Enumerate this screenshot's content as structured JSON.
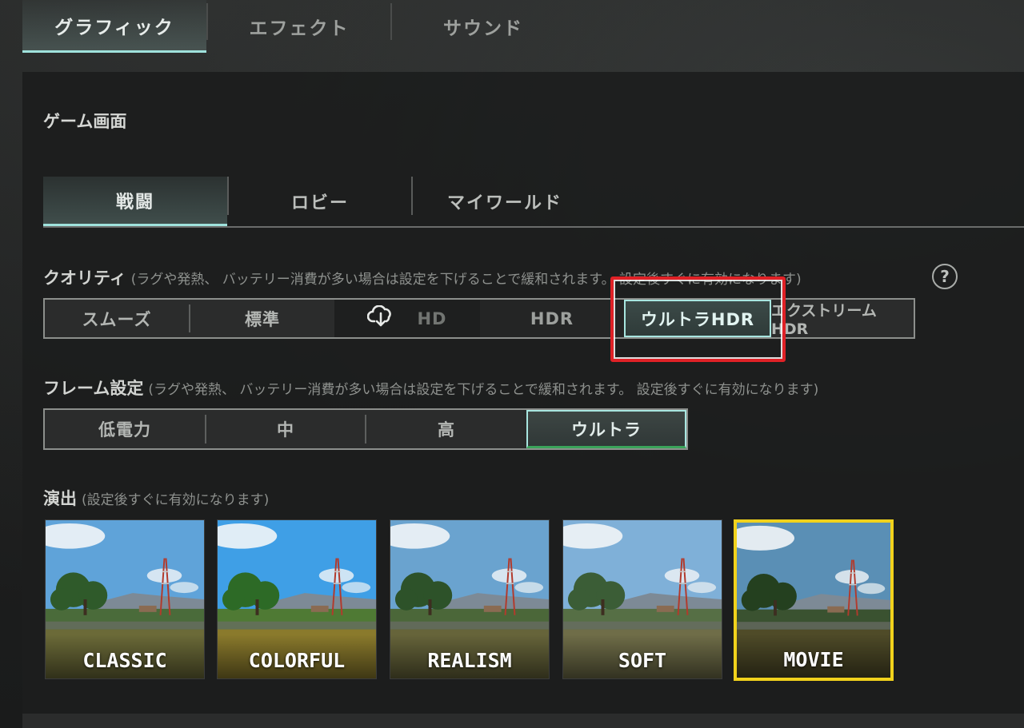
{
  "top_tabs": [
    "グラフィック",
    "エフェクト",
    "サウンド"
  ],
  "section_title": "ゲーム画面",
  "sub_tabs": [
    "戦闘",
    "ロビー",
    "マイワールド"
  ],
  "quality": {
    "label": "クオリティ",
    "note": "(ラグや発熱、 バッテリー消費が多い場合は設定を下げることで緩和されます。 設定後すぐに有効になります)",
    "options": [
      "スムーズ",
      "標準",
      "HD",
      "HDR",
      "ウルトラHDR",
      "エクストリームHDR"
    ],
    "selected": "ウルトラHDR",
    "help_icon": "?"
  },
  "frame": {
    "label": "フレーム設定",
    "note": "(ラグや発熱、 バッテリー消費が多い場合は設定を下げることで緩和されます。 設定後すぐに有効になります)",
    "options": [
      "低電力",
      "中",
      "高",
      "ウルトラ"
    ],
    "selected": "ウルトラ"
  },
  "style": {
    "label": "演出",
    "note": "(設定後すぐに有効になります)",
    "presets": [
      "CLASSIC",
      "COLORFUL",
      "REALISM",
      "SOFT",
      "MOVIE"
    ],
    "selected": "MOVIE"
  },
  "colors": {
    "accent": "#9fe2dc",
    "highlight_red": "#e02126",
    "selected_yellow": "#f1d21c"
  }
}
